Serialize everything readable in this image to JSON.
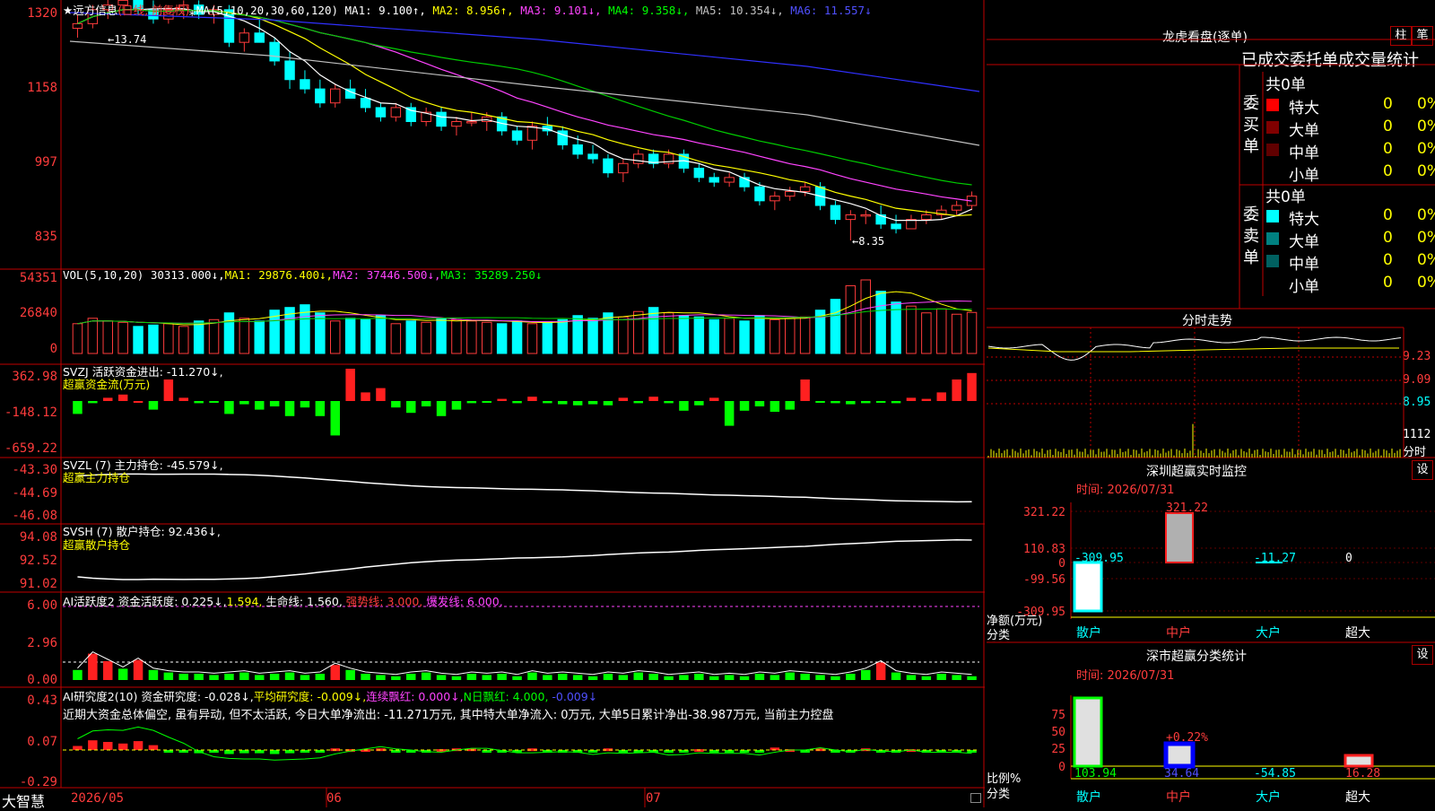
{
  "colors": {
    "up": "#ff3c3c",
    "down": "#00ffff",
    "ma1": "#ffffff",
    "ma2": "#ffff00",
    "ma3": "#ff44ff",
    "ma4": "#00cc00",
    "ma5": "#c0c0c0",
    "ma6": "#3030ff"
  },
  "main": {
    "title": "★远方信息",
    "mode": "(日线, 前复权)",
    "ma_label": "MA(5,10,20,30,60,120)",
    "ma1": "MA1: 9.100↑,",
    "ma2": "MA2: 8.956↑,",
    "ma3": "MA3: 9.101↓,",
    "ma4": "MA4: 9.358↓,",
    "ma5": "MA5: 10.354↓,",
    "ma6": "MA6: 11.557↓",
    "y_ticks": [
      "1320",
      "1158",
      "997",
      "835"
    ],
    "hi_label": "←13.74",
    "lo_label": "←8.35"
  },
  "vol": {
    "title": "VOL(5,10,20)",
    "value": "30313.000↓,",
    "ma1": "MA1: 29876.400↓,",
    "ma2": "MA2: 37446.500↓,",
    "ma3": "MA3: 35289.250↓",
    "y_ticks": [
      "54351",
      "26840",
      "0"
    ]
  },
  "svzj": {
    "title": "SVZJ  活跃资金进出: -11.270↓,",
    "sub": "超赢资金流(万元)",
    "y_ticks": [
      "362.98",
      "-148.12",
      "-659.22"
    ]
  },
  "svzl": {
    "title": "SVZL (7) 主力持仓: -45.579↓,",
    "sub": "超赢主力持仓",
    "y_ticks": [
      "-43.30",
      "-44.69",
      "-46.08"
    ]
  },
  "svsh": {
    "title": "SVSH (7) 散户持仓: 92.436↓,",
    "sub": "超赢散户持仓",
    "y_ticks": [
      "94.08",
      "92.52",
      "91.02"
    ]
  },
  "ai1": {
    "title": "AI活跃度2",
    "p1": "资金活跃度: 0.225↓,",
    "p2": "1.594,",
    "p3": "生命线: 1.560,",
    "p4": "强势线: 3.000,",
    "p5": "爆发线: 6.000,",
    "y_ticks": [
      "6.00",
      "2.96",
      "0.00"
    ]
  },
  "ai2": {
    "title": "AI研究度2(10)",
    "p1": "资金研究度: -0.028↓,",
    "p2": "平均研究度: -0.009↓,",
    "p3": "连续飘红: 0.000↓,",
    "p4": "N日飘红: 4.000,",
    "p5": "-0.009↓",
    "text": "近期大资金总体偏空, 虽有异动, 但不太活跃, 今日大单净流出: -11.271万元, 其中特大单净流入: 0万元, 大单5日累计净出-38.987万元, 当前主力控盘",
    "y_ticks": [
      "0.43",
      "0.07",
      "-0.29"
    ]
  },
  "bottom": {
    "brand": "大智慧",
    "dates": [
      "2026/05",
      "06",
      "07"
    ]
  },
  "right": {
    "lhb_title": "龙虎看盘(逐单)",
    "btn1": "柱",
    "btn2": "笔",
    "tabs_line": "已成交委托单成交量统计",
    "buy_label": "委买单",
    "sell_label": "委卖单",
    "buy_total": "共0单",
    "sell_total": "共0单",
    "buy_rows": [
      {
        "name": "特大",
        "val": "0",
        "pct": "0%",
        "color": "#ff0000"
      },
      {
        "name": "大单",
        "val": "0",
        "pct": "0%",
        "color": "#800000"
      },
      {
        "name": "中单",
        "val": "0",
        "pct": "0%",
        "color": "#600000"
      },
      {
        "name": "小单",
        "val": "0",
        "pct": "0%",
        "color": ""
      }
    ],
    "sell_rows": [
      {
        "name": "特大",
        "val": "0",
        "pct": "0%",
        "color": "#00ffff"
      },
      {
        "name": "大单",
        "val": "0",
        "pct": "0%",
        "color": "#008080"
      },
      {
        "name": "中单",
        "val": "0",
        "pct": "0%",
        "color": "#006060"
      },
      {
        "name": "小单",
        "val": "0",
        "pct": "0%",
        "color": ""
      }
    ],
    "fs_title": "分时走势",
    "fs_ticks": [
      "9.23",
      "9.09",
      "8.95"
    ],
    "fs_vol": "1112",
    "fs_vol_lbl": "分时",
    "mon_title": "深圳超赢实时监控",
    "mon_btn": "设",
    "mon_time": "时间: 2026/07/31",
    "mon_ticks": [
      "321.22",
      "110.83",
      "0",
      "-99.56",
      "-309.95"
    ],
    "mon_vals": [
      "-309.95",
      "321.22",
      "-11.27",
      "0"
    ],
    "mon_ylabel": "净额(万元)",
    "mon_xlabel": "分类",
    "cats": [
      "散户",
      "中户",
      "大户",
      "超大"
    ],
    "cls_title": "深市超赢分类统计",
    "cls_btn": "设",
    "cls_time": "时间: 2026/07/31",
    "cls_ticks": [
      "75",
      "50",
      "25",
      "0"
    ],
    "cls_vals": [
      "103.94",
      "34.64",
      "-54.85",
      "16.28"
    ],
    "cls_note": "+0.22%",
    "cls_ylabel": "比例%",
    "cls_xlabel": "分类"
  },
  "candles": [
    [
      12.9,
      13.2,
      12.7,
      13.0
    ],
    [
      13.0,
      13.4,
      12.9,
      13.3
    ],
    [
      13.3,
      13.74,
      13.1,
      13.4
    ],
    [
      13.4,
      13.6,
      13.2,
      13.5
    ],
    [
      13.5,
      13.6,
      13.2,
      13.3
    ],
    [
      13.3,
      13.5,
      13.0,
      13.1
    ],
    [
      13.1,
      13.4,
      13.0,
      13.3
    ],
    [
      13.3,
      13.5,
      13.1,
      13.4
    ],
    [
      13.4,
      13.5,
      13.1,
      13.2
    ],
    [
      13.2,
      13.4,
      13.0,
      13.3
    ],
    [
      13.3,
      13.4,
      12.5,
      12.6
    ],
    [
      12.6,
      12.9,
      12.4,
      12.8
    ],
    [
      12.8,
      13.1,
      12.6,
      12.6
    ],
    [
      12.6,
      12.7,
      12.1,
      12.2
    ],
    [
      12.2,
      12.4,
      11.6,
      11.8
    ],
    [
      11.8,
      12.0,
      11.5,
      11.6
    ],
    [
      11.6,
      11.8,
      11.2,
      11.3
    ],
    [
      11.3,
      11.7,
      11.2,
      11.6
    ],
    [
      11.6,
      11.8,
      11.4,
      11.4
    ],
    [
      11.4,
      11.6,
      11.1,
      11.2
    ],
    [
      11.2,
      11.3,
      10.9,
      11.0
    ],
    [
      11.0,
      11.3,
      10.9,
      11.2
    ],
    [
      11.2,
      11.3,
      10.8,
      10.9
    ],
    [
      10.9,
      11.2,
      10.8,
      11.1
    ],
    [
      11.1,
      11.2,
      10.7,
      10.8
    ],
    [
      10.8,
      11.0,
      10.6,
      10.9
    ],
    [
      10.9,
      11.1,
      10.8,
      10.9
    ],
    [
      10.9,
      11.1,
      10.7,
      11.0
    ],
    [
      11.0,
      11.1,
      10.6,
      10.7
    ],
    [
      10.7,
      10.8,
      10.4,
      10.5
    ],
    [
      10.5,
      10.9,
      10.3,
      10.8
    ],
    [
      10.8,
      11.0,
      10.6,
      10.7
    ],
    [
      10.7,
      10.8,
      10.3,
      10.4
    ],
    [
      10.4,
      10.6,
      10.1,
      10.2
    ],
    [
      10.2,
      10.4,
      10.0,
      10.1
    ],
    [
      10.1,
      10.2,
      9.7,
      9.8
    ],
    [
      9.8,
      10.1,
      9.6,
      10.0
    ],
    [
      10.0,
      10.3,
      9.9,
      10.2
    ],
    [
      10.2,
      10.3,
      9.9,
      10.0
    ],
    [
      10.0,
      10.3,
      9.9,
      10.2
    ],
    [
      10.2,
      10.3,
      9.8,
      9.9
    ],
    [
      9.9,
      10.0,
      9.6,
      9.7
    ],
    [
      9.7,
      9.8,
      9.5,
      9.6
    ],
    [
      9.6,
      9.8,
      9.5,
      9.7
    ],
    [
      9.7,
      9.8,
      9.4,
      9.5
    ],
    [
      9.5,
      9.6,
      9.1,
      9.2
    ],
    [
      9.2,
      9.4,
      9.0,
      9.3
    ],
    [
      9.3,
      9.5,
      9.2,
      9.4
    ],
    [
      9.4,
      9.6,
      9.3,
      9.5
    ],
    [
      9.5,
      9.6,
      9.0,
      9.1
    ],
    [
      9.1,
      9.2,
      8.7,
      8.8
    ],
    [
      8.8,
      9.0,
      8.35,
      8.9
    ],
    [
      8.9,
      9.0,
      8.7,
      8.9
    ],
    [
      8.9,
      9.1,
      8.6,
      8.7
    ],
    [
      8.7,
      8.9,
      8.5,
      8.6
    ],
    [
      8.6,
      8.9,
      8.6,
      8.8
    ],
    [
      8.8,
      9.0,
      8.7,
      8.9
    ],
    [
      8.9,
      9.1,
      8.8,
      9.0
    ],
    [
      9.0,
      9.2,
      8.9,
      9.1
    ],
    [
      9.1,
      9.4,
      9.0,
      9.3
    ]
  ],
  "volumes": [
    22000,
    26000,
    24000,
    23000,
    20000,
    21000,
    22000,
    20000,
    24000,
    25000,
    30000,
    26000,
    24000,
    32000,
    34000,
    36000,
    30000,
    24000,
    26000,
    25000,
    28000,
    22000,
    24000,
    23000,
    26000,
    25000,
    24000,
    23000,
    22000,
    24000,
    22000,
    23000,
    25000,
    28000,
    26000,
    30000,
    27000,
    31000,
    34000,
    30000,
    28000,
    27000,
    25000,
    26000,
    24000,
    28000,
    25000,
    26000,
    27000,
    32000,
    40000,
    50000,
    54351,
    46000,
    38000,
    35000,
    30000,
    33000,
    29000,
    30313
  ],
  "svzj_vals": [
    -120,
    -20,
    30,
    60,
    0,
    -80,
    200,
    30,
    -20,
    -10,
    -120,
    -30,
    -80,
    -50,
    -140,
    -60,
    -140,
    -320,
    300,
    80,
    120,
    -60,
    -110,
    -50,
    -140,
    -80,
    -20,
    -10,
    20,
    -20,
    40,
    -20,
    -30,
    -40,
    -30,
    -40,
    30,
    -20,
    40,
    -20,
    -90,
    -40,
    30,
    -230,
    -90,
    -50,
    -100,
    -80,
    200,
    -10,
    -20,
    -30,
    -20,
    -10,
    -20,
    30,
    20,
    80,
    200,
    260,
    -110,
    -40,
    -10,
    40,
    30,
    20
  ],
  "ai1_vals": [
    0.8,
    2.1,
    1.5,
    0.9,
    1.6,
    0.8,
    0.6,
    0.5,
    0.5,
    0.4,
    0.5,
    0.6,
    0.4,
    0.5,
    0.6,
    0.4,
    0.5,
    1.2,
    0.8,
    0.5,
    0.4,
    0.3,
    0.5,
    0.6,
    0.4,
    0.3,
    0.5,
    0.4,
    0.5,
    0.3,
    0.6,
    0.4,
    0.5,
    0.4,
    0.3,
    0.5,
    0.4,
    0.6,
    0.5,
    0.3,
    0.4,
    0.5,
    0.3,
    0.4,
    0.3,
    0.5,
    0.4,
    0.6,
    0.5,
    0.4,
    0.3,
    0.5,
    0.8,
    1.4,
    0.6,
    0.4,
    0.3,
    0.5,
    0.4,
    0.3
  ],
  "ai2_vals": [
    0.05,
    0.12,
    0.1,
    0.08,
    0.11,
    0.06,
    -0.02,
    -0.03,
    -0.04,
    -0.03,
    -0.05,
    -0.04,
    -0.04,
    -0.05,
    -0.04,
    -0.03,
    -0.02,
    0.02,
    0.01,
    0.01,
    0.02,
    -0.02,
    -0.01,
    -0.02,
    0.01,
    0.02,
    0.02,
    -0.02,
    -0.03,
    -0.02,
    0.02,
    -0.01,
    -0.02,
    -0.03,
    -0.02,
    0.02,
    -0.03,
    -0.02,
    -0.01,
    -0.03,
    -0.02,
    0.01,
    -0.02,
    -0.03,
    -0.02,
    -0.02,
    0.03,
    0.01,
    -0.02,
    0.02,
    -0.01,
    -0.02,
    0.02,
    -0.01,
    -0.02,
    0.01,
    -0.02,
    -0.01,
    -0.02,
    -0.01
  ]
}
